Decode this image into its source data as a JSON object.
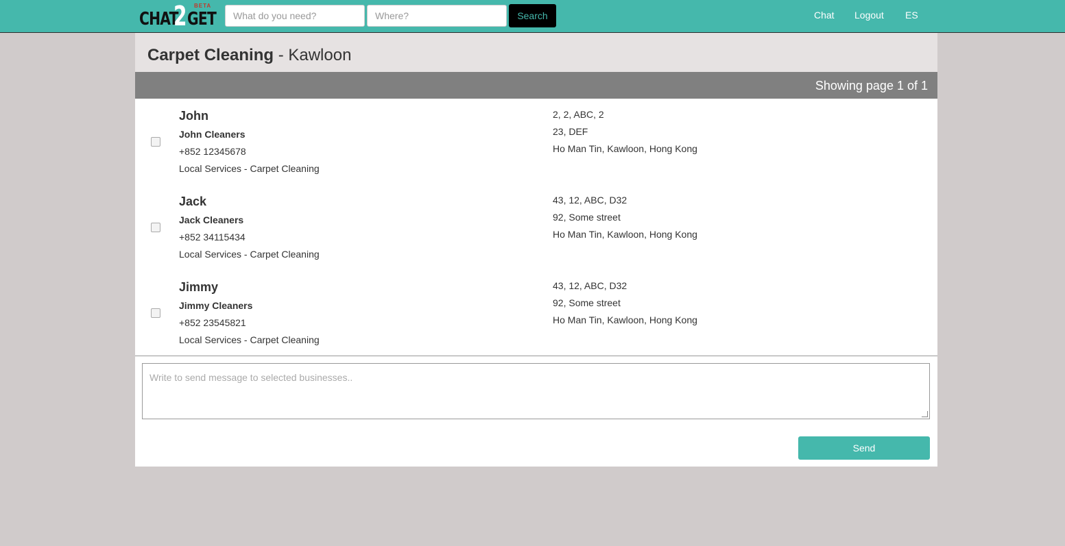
{
  "brand": {
    "logo_part1": "CHAT",
    "logo_digit": "2",
    "logo_part2": "GET",
    "logo_badge": "BETA"
  },
  "search": {
    "what_placeholder": "What do you need?",
    "where_placeholder": "Where?",
    "button_label": "Search"
  },
  "nav": {
    "chat": "Chat",
    "logout": "Logout",
    "language": "ES"
  },
  "results": {
    "category": "Carpet Cleaning",
    "separator": " - ",
    "location": "Kawloon",
    "pager": "Showing page 1 of 1",
    "items": [
      {
        "name": "John",
        "business": "John Cleaners",
        "phone": "+852 12345678",
        "category": "Local Services - Carpet Cleaning",
        "address_line1": "2, 2, ABC, 2",
        "address_line2": "23, DEF",
        "address_line3": "Ho Man Tin, Kawloon, Hong Kong",
        "selected": false
      },
      {
        "name": "Jack",
        "business": "Jack Cleaners",
        "phone": "+852 34115434",
        "category": "Local Services - Carpet Cleaning",
        "address_line1": "43, 12, ABC, D32",
        "address_line2": "92, Some street",
        "address_line3": "Ho Man Tin, Kawloon, Hong Kong",
        "selected": false
      },
      {
        "name": "Jimmy",
        "business": "Jimmy Cleaners",
        "phone": "+852 23545821",
        "category": "Local Services - Carpet Cleaning",
        "address_line1": "43, 12, ABC, D32",
        "address_line2": "92, Some street",
        "address_line3": "Ho Man Tin, Kawloon, Hong Kong",
        "selected": false
      }
    ]
  },
  "composer": {
    "placeholder": "Write to send message to selected businesses..",
    "send_label": "Send"
  },
  "colors": {
    "accent": "#45b8ac",
    "background": "#d0cbcb",
    "pager_bar": "#808080"
  }
}
